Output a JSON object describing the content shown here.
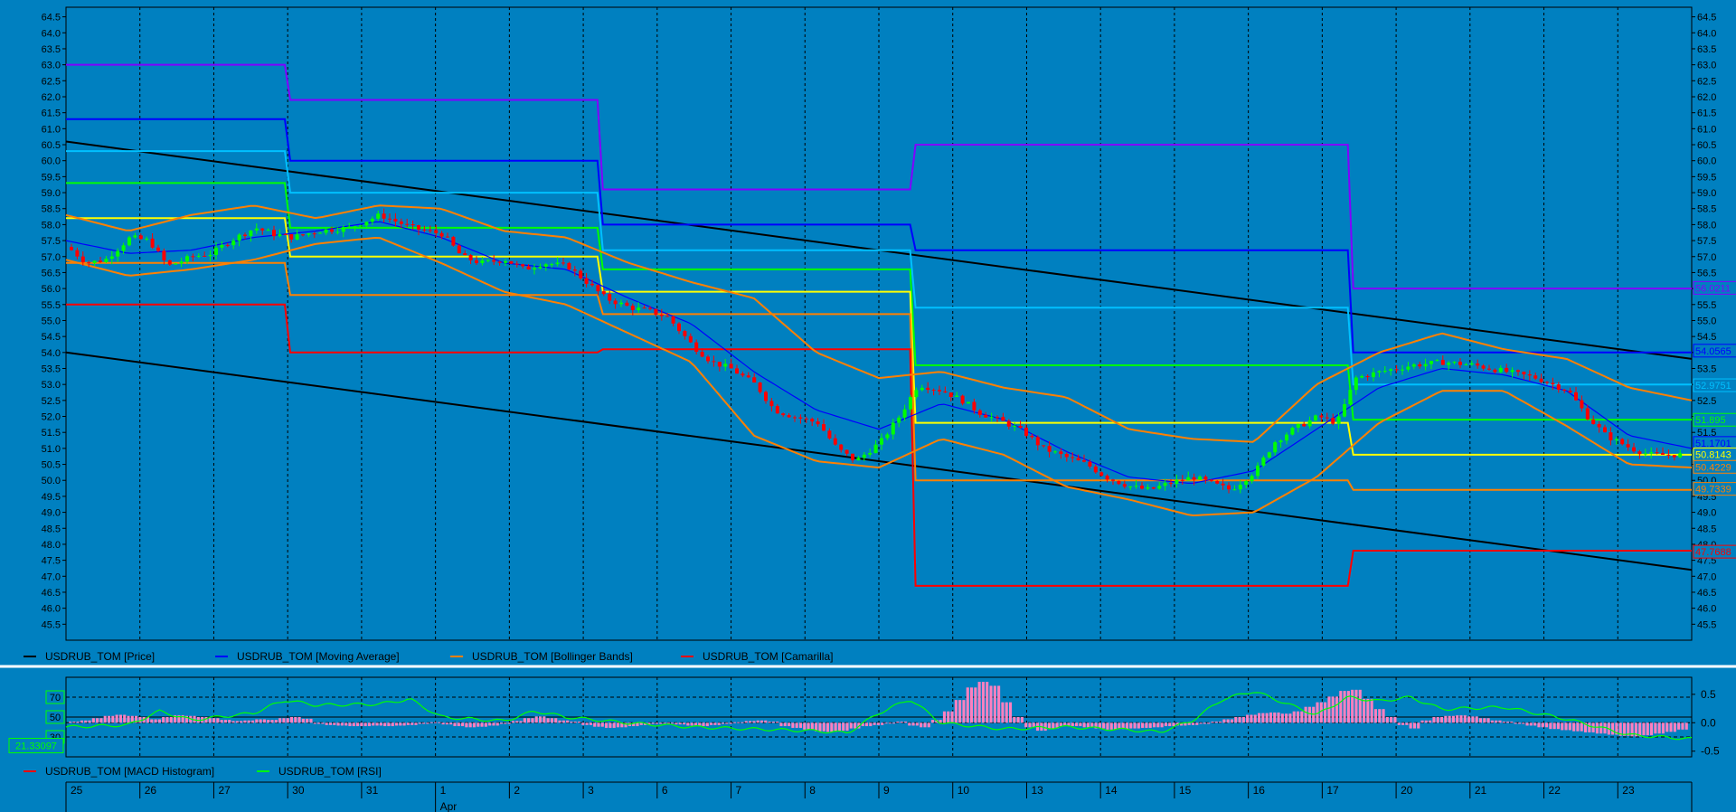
{
  "colors": {
    "background": "#0080c0",
    "axis": "#000000",
    "grid": "#000000",
    "separator": "#ffffff",
    "up_candle": "#00ff00",
    "down_candle": "#ff0000",
    "moving_average": "#0000ff",
    "bollinger": "#ff8000",
    "channel": "#000000",
    "camarilla": [
      "#8000ff",
      "#0000ff",
      "#00c0ff",
      "#00ff00",
      "#ffff00",
      "#ff8000",
      "#ff0000"
    ],
    "macd_histogram": "#ff80c0",
    "rsi": "#00ff00"
  },
  "legend_price": [
    {
      "label": "USDRUB_TOM [Price]",
      "color": "#000000"
    },
    {
      "label": "USDRUB_TOM [Moving Average]",
      "color": "#0000ff"
    },
    {
      "label": "USDRUB_TOM [Bollinger Bands]",
      "color": "#ff8000"
    },
    {
      "label": "USDRUB_TOM [Camarilla]",
      "color": "#ff0000"
    }
  ],
  "legend_indicator": [
    {
      "label": "USDRUB_TOM [MACD Histogram]",
      "color": "#ff0000"
    },
    {
      "label": "USDRUB_TOM [RSI]",
      "color": "#00ff00"
    }
  ],
  "chart_data": [
    {
      "type": "candlestick",
      "symbol": "USDRUB_TOM",
      "ylim": [
        45.0,
        64.8
      ],
      "y_ticks": [
        "64.5",
        "64.0",
        "63.5",
        "63.0",
        "62.5",
        "62.0",
        "61.5",
        "61.0",
        "60.5",
        "60.0",
        "59.5",
        "59.0",
        "58.5",
        "58.0",
        "57.5",
        "57.0",
        "56.5",
        "56.0",
        "55.5",
        "55.0",
        "54.5",
        "54.0",
        "53.5",
        "53.0",
        "52.5",
        "52.0",
        "51.5",
        "51.0",
        "50.5",
        "50.0",
        "49.5",
        "49.0",
        "48.5",
        "48.0",
        "47.5",
        "47.0",
        "46.5",
        "46.0",
        "45.5"
      ],
      "x_days": [
        "25",
        "26",
        "27",
        "30",
        "31",
        "1",
        "2",
        "3",
        "6",
        "7",
        "8",
        "9",
        "10",
        "13",
        "14",
        "15",
        "16",
        "17",
        "20",
        "21",
        "22",
        "23"
      ],
      "x_month_label": "Apr",
      "close_path": [
        [
          0,
          57.3
        ],
        [
          0.3,
          56.8
        ],
        [
          0.6,
          56.9
        ],
        [
          1.0,
          57.6
        ],
        [
          1.3,
          57.5
        ],
        [
          1.6,
          56.7
        ],
        [
          2.0,
          57.0
        ],
        [
          2.3,
          57.1
        ],
        [
          2.6,
          57.5
        ],
        [
          3.0,
          57.9
        ],
        [
          3.3,
          57.7
        ],
        [
          3.6,
          57.6
        ],
        [
          4.0,
          57.8
        ],
        [
          4.5,
          57.9
        ],
        [
          5.0,
          58.3
        ],
        [
          5.5,
          57.9
        ],
        [
          6.0,
          57.7
        ],
        [
          6.3,
          57.0
        ],
        [
          6.6,
          56.8
        ],
        [
          7.0,
          56.9
        ],
        [
          7.3,
          56.6
        ],
        [
          7.6,
          56.8
        ],
        [
          8.0,
          56.7
        ],
        [
          8.3,
          56.2
        ],
        [
          8.6,
          55.7
        ],
        [
          9.0,
          55.4
        ],
        [
          9.3,
          55.3
        ],
        [
          9.6,
          55.1
        ],
        [
          10.0,
          54.2
        ],
        [
          10.3,
          53.7
        ],
        [
          10.6,
          53.5
        ],
        [
          11.0,
          53.0
        ],
        [
          11.3,
          52.2
        ],
        [
          11.6,
          52.0
        ],
        [
          12.0,
          51.8
        ],
        [
          12.3,
          51.0
        ],
        [
          12.6,
          50.6
        ],
        [
          13.0,
          51.2
        ],
        [
          13.3,
          52.0
        ],
        [
          13.6,
          53.0
        ],
        [
          14.0,
          52.8
        ],
        [
          14.3,
          52.5
        ],
        [
          14.6,
          52.1
        ],
        [
          15.0,
          51.8
        ],
        [
          15.3,
          51.5
        ],
        [
          15.6,
          51.0
        ],
        [
          16.0,
          50.7
        ],
        [
          16.3,
          50.5
        ],
        [
          16.6,
          50.1
        ],
        [
          17.0,
          49.8
        ],
        [
          17.3,
          49.7
        ],
        [
          17.6,
          49.9
        ],
        [
          18.0,
          50.1
        ],
        [
          18.3,
          49.9
        ],
        [
          18.6,
          49.7
        ],
        [
          19.0,
          50.3
        ],
        [
          19.3,
          51.2
        ],
        [
          19.6,
          51.6
        ],
        [
          20.0,
          52.0
        ],
        [
          20.3,
          51.8
        ],
        [
          20.6,
          53.2
        ],
        [
          21.0,
          53.4
        ],
        [
          21.5,
          53.6
        ],
        [
          22.0,
          53.7
        ],
        [
          22.5,
          53.6
        ],
        [
          23.0,
          53.4
        ],
        [
          23.5,
          53.2
        ],
        [
          24.0,
          52.8
        ],
        [
          24.3,
          52.0
        ],
        [
          24.6,
          51.4
        ],
        [
          25.0,
          51.0
        ],
        [
          25.3,
          50.8
        ],
        [
          25.6,
          50.8
        ],
        [
          26.0,
          50.8
        ]
      ],
      "moving_average_path": [
        [
          0,
          57.5
        ],
        [
          1,
          57.1
        ],
        [
          2,
          57.2
        ],
        [
          3,
          57.6
        ],
        [
          4,
          57.8
        ],
        [
          5,
          58.1
        ],
        [
          6,
          57.6
        ],
        [
          7,
          56.8
        ],
        [
          8,
          56.6
        ],
        [
          9,
          55.7
        ],
        [
          10,
          54.9
        ],
        [
          11,
          53.4
        ],
        [
          12,
          52.2
        ],
        [
          13,
          51.6
        ],
        [
          14,
          52.4
        ],
        [
          15,
          51.9
        ],
        [
          16,
          50.9
        ],
        [
          17,
          50.1
        ],
        [
          18,
          49.9
        ],
        [
          19,
          50.3
        ],
        [
          20,
          51.6
        ],
        [
          21,
          52.9
        ],
        [
          22,
          53.5
        ],
        [
          23,
          53.3
        ],
        [
          24,
          52.8
        ],
        [
          25,
          51.4
        ],
        [
          26,
          51.0
        ]
      ],
      "bollinger_upper_path": [
        [
          0,
          58.3
        ],
        [
          1,
          57.8
        ],
        [
          2,
          58.3
        ],
        [
          3,
          58.6
        ],
        [
          4,
          58.2
        ],
        [
          5,
          58.6
        ],
        [
          6,
          58.5
        ],
        [
          7,
          57.8
        ],
        [
          8,
          57.6
        ],
        [
          9,
          56.8
        ],
        [
          10,
          56.2
        ],
        [
          11,
          55.7
        ],
        [
          12,
          54.0
        ],
        [
          13,
          53.2
        ],
        [
          14,
          53.4
        ],
        [
          15,
          52.9
        ],
        [
          16,
          52.6
        ],
        [
          17,
          51.6
        ],
        [
          18,
          51.3
        ],
        [
          19,
          51.2
        ],
        [
          20,
          53.0
        ],
        [
          21,
          54.0
        ],
        [
          22,
          54.6
        ],
        [
          23,
          54.1
        ],
        [
          24,
          53.8
        ],
        [
          25,
          52.9
        ],
        [
          26,
          52.5
        ]
      ],
      "bollinger_lower_path": [
        [
          0,
          56.9
        ],
        [
          1,
          56.4
        ],
        [
          2,
          56.6
        ],
        [
          3,
          56.9
        ],
        [
          4,
          57.4
        ],
        [
          5,
          57.6
        ],
        [
          6,
          56.8
        ],
        [
          7,
          55.9
        ],
        [
          8,
          55.5
        ],
        [
          9,
          54.6
        ],
        [
          10,
          53.7
        ],
        [
          11,
          51.4
        ],
        [
          12,
          50.6
        ],
        [
          13,
          50.4
        ],
        [
          14,
          51.3
        ],
        [
          15,
          50.8
        ],
        [
          16,
          49.8
        ],
        [
          17,
          49.4
        ],
        [
          18,
          48.9
        ],
        [
          19,
          49.0
        ],
        [
          20,
          50.1
        ],
        [
          21,
          51.8
        ],
        [
          22,
          52.8
        ],
        [
          23,
          52.8
        ],
        [
          24,
          51.7
        ],
        [
          25,
          50.5
        ],
        [
          26,
          50.4
        ]
      ],
      "channel_upper": [
        [
          0,
          60.6
        ],
        [
          26,
          53.8
        ]
      ],
      "channel_lower": [
        [
          0,
          54.0
        ],
        [
          26,
          47.2
        ]
      ],
      "camarilla_segments": [
        {
          "x": [
            0,
            3.5
          ],
          "levels": [
            63.0,
            61.3,
            60.3,
            59.3,
            58.2,
            56.8,
            55.5
          ]
        },
        {
          "x": [
            3.5,
            8.5
          ],
          "levels": [
            61.9,
            60.0,
            59.0,
            57.9,
            57.0,
            55.8,
            54.0
          ]
        },
        {
          "x": [
            8.5,
            13.5
          ],
          "levels": [
            59.1,
            58.0,
            57.2,
            56.6,
            55.9,
            55.2,
            54.1
          ]
        },
        {
          "x": [
            13.5,
            20.5
          ],
          "levels": [
            60.5,
            57.2,
            55.4,
            53.6,
            51.8,
            50.0,
            46.7
          ]
        },
        {
          "x": [
            20.5,
            26
          ],
          "levels": [
            56.0,
            54.0,
            53.0,
            51.9,
            50.8,
            49.7,
            47.8
          ]
        }
      ],
      "price_labels": [
        {
          "value": "56.0211",
          "color": "#8000ff"
        },
        {
          "value": "54.0565",
          "color": "#0000ff"
        },
        {
          "value": "52.9751",
          "color": "#00c0ff"
        },
        {
          "value": "51.895",
          "color": "#00ff00"
        },
        {
          "value": "51.1701",
          "color": "#0000ff"
        },
        {
          "value": "50.8143",
          "color": "#ffff00"
        },
        {
          "value": "50.4229",
          "color": "#ff8000"
        },
        {
          "value": "49.7339",
          "color": "#ff8000"
        },
        {
          "value": "47.7688",
          "color": "#ff0000"
        }
      ]
    },
    {
      "type": "histogram+line",
      "name_left": "RSI",
      "rsi_ticks": [
        "70",
        "50",
        "30"
      ],
      "rsi_ylim": [
        10,
        90
      ],
      "macd_ticks": [
        "0.5",
        "0.0",
        "-0.5"
      ],
      "macd_ylim": [
        -0.6,
        0.8
      ],
      "current_rsi": "21.33097",
      "rsi_path": [
        [
          0,
          40
        ],
        [
          1,
          42
        ],
        [
          1.5,
          56
        ],
        [
          2,
          47
        ],
        [
          3,
          54
        ],
        [
          3.5,
          67
        ],
        [
          4,
          62
        ],
        [
          5,
          63
        ],
        [
          5.5,
          68
        ],
        [
          6,
          50
        ],
        [
          7,
          46
        ],
        [
          7.5,
          56
        ],
        [
          8,
          50
        ],
        [
          9,
          44
        ],
        [
          10,
          40
        ],
        [
          11,
          38
        ],
        [
          12,
          36
        ],
        [
          12.5,
          34
        ],
        [
          13,
          54
        ],
        [
          13.5,
          68
        ],
        [
          14,
          44
        ],
        [
          15,
          38
        ],
        [
          16,
          40
        ],
        [
          17,
          37
        ],
        [
          17.5,
          35
        ],
        [
          18,
          46
        ],
        [
          18.5,
          68
        ],
        [
          19,
          76
        ],
        [
          20,
          52
        ],
        [
          20.5,
          70
        ],
        [
          21,
          66
        ],
        [
          21.5,
          70
        ],
        [
          22,
          58
        ],
        [
          23,
          60
        ],
        [
          24,
          48
        ],
        [
          25,
          32
        ],
        [
          26,
          28
        ]
      ],
      "macd_bars": [
        0.02,
        0.04,
        0.08,
        0.12,
        0.14,
        0.12,
        0.1,
        0.06,
        0.1,
        0.13,
        0.12,
        0.1,
        0.08,
        0.05,
        0.03,
        0.04,
        0.06,
        0.05,
        0.08,
        0.1,
        0.07,
        -0.02,
        -0.04,
        -0.05,
        -0.06,
        -0.06,
        -0.05,
        -0.06,
        -0.05,
        -0.04,
        -0.02,
        0.01,
        -0.03,
        -0.06,
        -0.08,
        -0.07,
        -0.05,
        -0.02,
        0.03,
        0.08,
        0.11,
        0.08,
        0.04,
        0.02,
        -0.04,
        -0.07,
        -0.09,
        -0.08,
        -0.06,
        -0.04,
        -0.02,
        -0.01,
        -0.03,
        -0.05,
        -0.06,
        -0.04,
        -0.02,
        0.01,
        0.03,
        0.04,
        0.02,
        -0.06,
        -0.09,
        -0.12,
        -0.15,
        -0.16,
        -0.14,
        -0.1,
        -0.06,
        -0.04,
        -0.01,
        0.02,
        -0.05,
        -0.08,
        0.05,
        0.2,
        0.4,
        0.62,
        0.72,
        0.65,
        0.36,
        0.1,
        -0.08,
        -0.14,
        -0.1,
        -0.06,
        -0.06,
        -0.08,
        -0.1,
        -0.12,
        -0.11,
        -0.1,
        -0.09,
        -0.08,
        -0.06,
        -0.05,
        -0.04,
        -0.02,
        0.02,
        0.06,
        0.1,
        0.14,
        0.17,
        0.18,
        0.16,
        0.2,
        0.28,
        0.36,
        0.46,
        0.56,
        0.58,
        0.42,
        0.24,
        0.1,
        -0.04,
        -0.1,
        0.04,
        0.1,
        0.12,
        0.13,
        0.11,
        0.08,
        0.04,
        0.02,
        -0.02,
        -0.05,
        -0.08,
        -0.11,
        -0.13,
        -0.15,
        -0.17,
        -0.19,
        -0.21,
        -0.23,
        -0.24,
        -0.22,
        -0.19,
        -0.16,
        -0.12
      ]
    }
  ]
}
